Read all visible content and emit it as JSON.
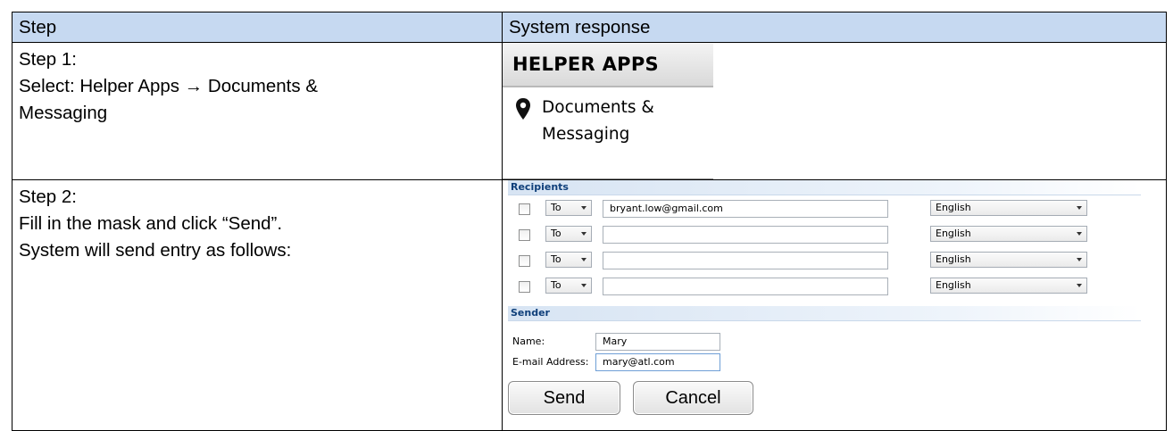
{
  "table": {
    "header_step": "Step",
    "header_response": "System response"
  },
  "step1": {
    "line1": "Step 1:",
    "line2": "Select: Helper Apps → Documents &",
    "line3": "Messaging"
  },
  "helper_panel": {
    "title": "HELPER APPS",
    "item_line1": "Documents &",
    "item_line2": "Messaging",
    "item_icon": "map-pin-icon"
  },
  "step2": {
    "line1": "Step 2:",
    "line2": "Fill in the mask and click “Send”.",
    "line3": "System will send entry as follows:"
  },
  "form": {
    "recipients_header": "Recipients",
    "recipients": [
      {
        "type": "To",
        "email": "bryant.low@gmail.com",
        "language": "English"
      },
      {
        "type": "To",
        "email": "",
        "language": "English"
      },
      {
        "type": "To",
        "email": "",
        "language": "English"
      },
      {
        "type": "To",
        "email": "",
        "language": "English"
      }
    ],
    "sender_header": "Sender",
    "name_label": "Name:",
    "name_value": "Mary",
    "email_label": "E-mail Address:",
    "email_value": "mary@atl.com",
    "send_label": "Send",
    "cancel_label": "Cancel"
  }
}
